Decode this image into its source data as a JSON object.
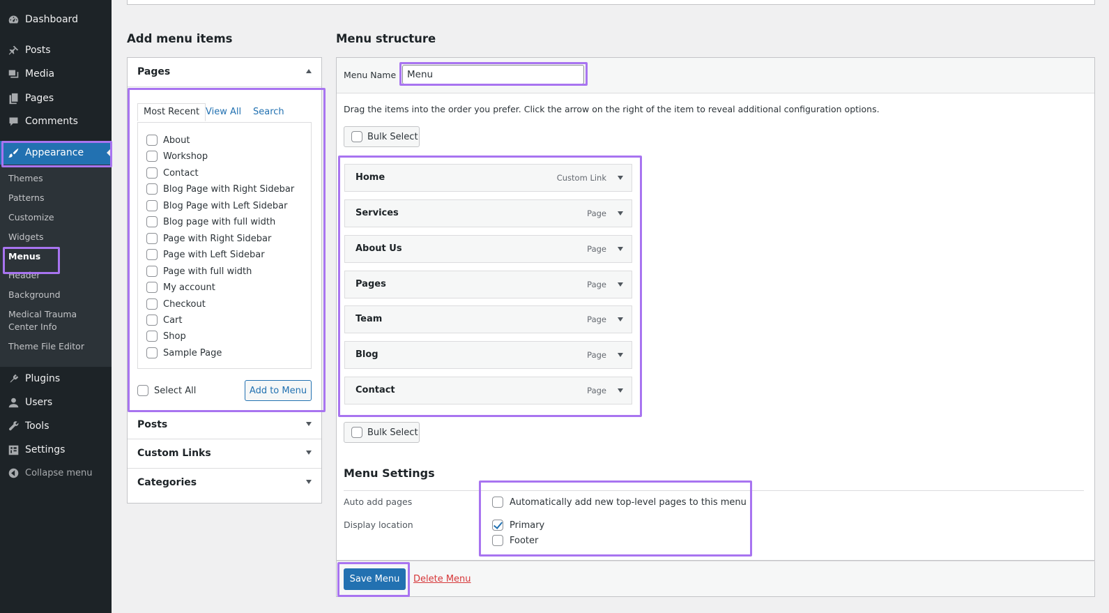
{
  "sidebar": {
    "top_items": [
      {
        "label": "Dashboard",
        "icon": "dashboard-icon"
      },
      {
        "label": "Posts",
        "icon": "pushpin-icon"
      },
      {
        "label": "Media",
        "icon": "media-icon"
      },
      {
        "label": "Pages",
        "icon": "pages-icon"
      },
      {
        "label": "Comments",
        "icon": "comment-icon"
      },
      {
        "label": "Appearance",
        "icon": "brush-icon"
      },
      {
        "label": "Plugins",
        "icon": "plugin-icon"
      },
      {
        "label": "Users",
        "icon": "user-icon"
      },
      {
        "label": "Tools",
        "icon": "wrench-icon"
      },
      {
        "label": "Settings",
        "icon": "settings-icon"
      },
      {
        "label": "Collapse menu",
        "icon": "collapse-icon"
      }
    ],
    "sub_items": [
      "Themes",
      "Patterns",
      "Customize",
      "Widgets",
      "Menus",
      "Header",
      "Background",
      "Medical Trauma Center Info",
      "Theme File Editor"
    ]
  },
  "add_items": {
    "title": "Add menu items",
    "sections": {
      "pages": "Pages",
      "posts": "Posts",
      "custom_links": "Custom Links",
      "categories": "Categories"
    },
    "tabs": [
      "Most Recent",
      "View All",
      "Search"
    ],
    "pages": [
      "About",
      "Workshop",
      "Contact",
      "Blog Page with Right Sidebar",
      "Blog Page with Left Sidebar",
      "Blog page with full width",
      "Page with Right Sidebar",
      "Page with Left Sidebar",
      "Page with full width",
      "My account",
      "Checkout",
      "Cart",
      "Shop",
      "Sample Page"
    ],
    "select_all": "Select All",
    "add_button": "Add to Menu"
  },
  "menu_structure": {
    "title": "Menu structure",
    "name_label": "Menu Name",
    "name_value": "Menu",
    "instructions": "Drag the items into the order you prefer. Click the arrow on the right of the item to reveal additional configuration options.",
    "bulk_select": "Bulk Select",
    "items": [
      {
        "title": "Home",
        "type": "Custom Link"
      },
      {
        "title": "Services",
        "type": "Page"
      },
      {
        "title": "About Us",
        "type": "Page"
      },
      {
        "title": "Pages",
        "type": "Page"
      },
      {
        "title": "Team",
        "type": "Page"
      },
      {
        "title": "Blog",
        "type": "Page"
      },
      {
        "title": "Contact",
        "type": "Page"
      }
    ]
  },
  "menu_settings": {
    "title": "Menu Settings",
    "auto_add_label": "Auto add pages",
    "auto_add_option": "Automatically add new top-level pages to this menu",
    "auto_add_checked": false,
    "display_location_label": "Display location",
    "locations": [
      {
        "label": "Primary",
        "checked": true
      },
      {
        "label": "Footer",
        "checked": false
      }
    ]
  },
  "footer": {
    "save": "Save Menu",
    "delete": "Delete Menu"
  },
  "colors": {
    "accent": "#2271b1",
    "highlight": "#a874f0",
    "sidebar_bg": "#1d2327",
    "danger": "#d63638"
  }
}
